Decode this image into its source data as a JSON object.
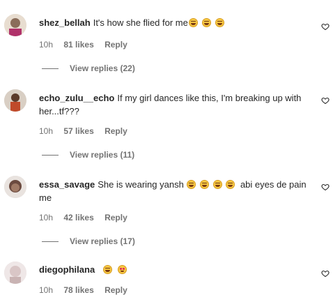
{
  "comments": [
    {
      "username": "shez_bellah",
      "text": "It's how she flied for me",
      "emojis_after": [
        "laugh",
        "laugh",
        "laugh"
      ],
      "time": "10h",
      "likes": "81 likes",
      "reply": "Reply",
      "view_replies": "View replies (22)",
      "avatar_color": "#8a6d5a"
    },
    {
      "username": "echo_zulu__echo",
      "text": "If my girl dances like this, I'm breaking up with her...tf???",
      "time": "10h",
      "likes": "57 likes",
      "reply": "Reply",
      "view_replies": "View replies (11)",
      "avatar_color": "#c04a2a"
    },
    {
      "username": "essa_savage",
      "text_before": "She is wearing yansh",
      "text_after": "abi eyes de pain me",
      "emojis_middle": [
        "laugh",
        "laugh",
        "laugh",
        "laugh"
      ],
      "time": "10h",
      "likes": "42 likes",
      "reply": "Reply",
      "view_replies": "View replies (17)",
      "avatar_color": "#6b4a3f"
    },
    {
      "username": "diegophilana",
      "emojis_after": [
        "laugh",
        "hearts"
      ],
      "time": "10h",
      "likes": "78 likes",
      "reply": "Reply",
      "avatar_color": "#d9c6c6"
    }
  ]
}
